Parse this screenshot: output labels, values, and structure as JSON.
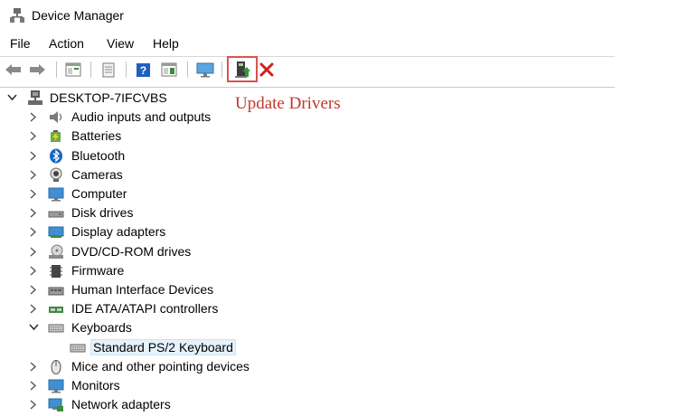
{
  "window": {
    "title": "Device Manager"
  },
  "menu": {
    "file": "File",
    "action": "Action",
    "view": "View",
    "help": "Help"
  },
  "toolbar": {
    "buttons": [
      "back-icon",
      "forward-icon",
      "properties-pane-icon",
      "properties-icon",
      "help-icon",
      "action-pane-icon",
      "monitor-icon",
      "update-driver-icon",
      "uninstall-icon"
    ],
    "annotation": "Update Drivers",
    "highlight_color": "#d9534f",
    "annotation_color": "#c0392b"
  },
  "tree": {
    "root": "DESKTOP-7IFCVBS",
    "items": [
      {
        "label": "Audio inputs and outputs",
        "icon": "speaker-icon",
        "expanded": false
      },
      {
        "label": "Batteries",
        "icon": "battery-icon",
        "expanded": false
      },
      {
        "label": "Bluetooth",
        "icon": "bluetooth-icon",
        "expanded": false
      },
      {
        "label": "Cameras",
        "icon": "camera-icon",
        "expanded": false
      },
      {
        "label": "Computer",
        "icon": "computer-icon",
        "expanded": false
      },
      {
        "label": "Disk drives",
        "icon": "disk-drive-icon",
        "expanded": false
      },
      {
        "label": "Display adapters",
        "icon": "display-adapter-icon",
        "expanded": false
      },
      {
        "label": "DVD/CD-ROM drives",
        "icon": "dvd-drive-icon",
        "expanded": false
      },
      {
        "label": "Firmware",
        "icon": "firmware-icon",
        "expanded": false
      },
      {
        "label": "Human Interface Devices",
        "icon": "hid-icon",
        "expanded": false
      },
      {
        "label": "IDE ATA/ATAPI controllers",
        "icon": "ide-controller-icon",
        "expanded": false
      },
      {
        "label": "Keyboards",
        "icon": "keyboard-icon",
        "expanded": true
      },
      {
        "label": "Standard PS/2 Keyboard",
        "icon": "keyboard-icon",
        "child": true,
        "selected": true
      },
      {
        "label": "Mice and other pointing devices",
        "icon": "mouse-icon",
        "expanded": false
      },
      {
        "label": "Monitors",
        "icon": "monitor-icon",
        "expanded": false
      },
      {
        "label": "Network adapters",
        "icon": "network-adapter-icon",
        "expanded": false
      }
    ]
  }
}
